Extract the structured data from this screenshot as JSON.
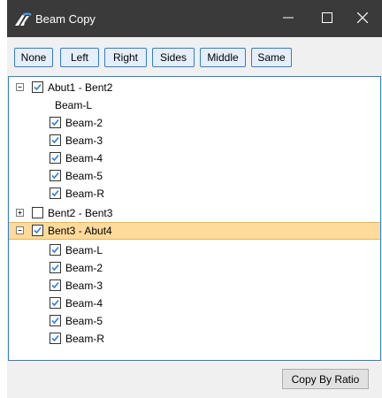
{
  "window": {
    "title": "Beam Copy",
    "colors": {
      "titlebar": "#3a3a3a",
      "accent": "#2f7fd6",
      "selected_row": "#ffdb9b",
      "check": "#2f7fd6"
    }
  },
  "toolbar": {
    "buttons": [
      "None",
      "Left",
      "Right",
      "Sides",
      "Middle",
      "Same"
    ]
  },
  "tree": {
    "groups": [
      {
        "label": "Abut1 - Bent2",
        "expanded": true,
        "checked": true,
        "children": [
          {
            "label": "Beam-L",
            "checkbox": false
          },
          {
            "label": "Beam-2",
            "checkbox": true,
            "checked": true
          },
          {
            "label": "Beam-3",
            "checkbox": true,
            "checked": true
          },
          {
            "label": "Beam-4",
            "checkbox": true,
            "checked": true
          },
          {
            "label": "Beam-5",
            "checkbox": true,
            "checked": true
          },
          {
            "label": "Beam-R",
            "checkbox": true,
            "checked": true
          }
        ]
      },
      {
        "label": "Bent2 - Bent3",
        "expanded": false,
        "checked": false,
        "children": []
      },
      {
        "label": "Bent3 - Abut4",
        "expanded": true,
        "checked": true,
        "selected": true,
        "children": [
          {
            "label": "Beam-L",
            "checkbox": true,
            "checked": true
          },
          {
            "label": "Beam-2",
            "checkbox": true,
            "checked": true
          },
          {
            "label": "Beam-3",
            "checkbox": true,
            "checked": true
          },
          {
            "label": "Beam-4",
            "checkbox": true,
            "checked": true
          },
          {
            "label": "Beam-5",
            "checkbox": true,
            "checked": true
          },
          {
            "label": "Beam-R",
            "checkbox": true,
            "checked": true
          }
        ]
      }
    ]
  },
  "footer": {
    "copy_label": "Copy By Ratio"
  }
}
